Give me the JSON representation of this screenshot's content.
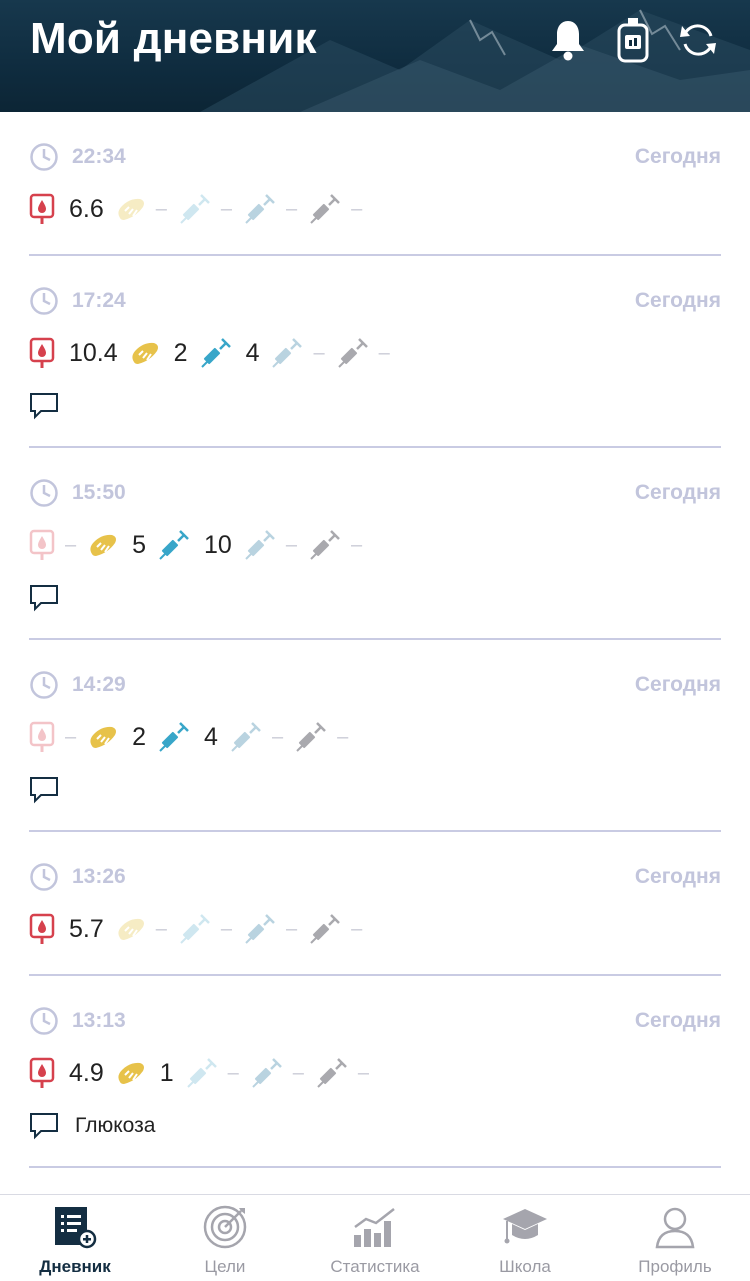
{
  "header": {
    "title": "Мой дневник"
  },
  "colors": {
    "glucose": "#d6414d",
    "bread": "#e7c24a",
    "short_insulin": "#38a6c9",
    "long_insulin": "#b9d3e0",
    "other_insulin": "#a9a9ae",
    "accent": "#142e42"
  },
  "entries": [
    {
      "time": "22:34",
      "day": "Сегодня",
      "glucose": "6.6",
      "bread": "",
      "short": "",
      "long": "",
      "other": "",
      "comment": null
    },
    {
      "time": "17:24",
      "day": "Сегодня",
      "glucose": "10.4",
      "bread": "2",
      "short": "4",
      "long": "",
      "other": "",
      "comment": ""
    },
    {
      "time": "15:50",
      "day": "Сегодня",
      "glucose": "",
      "bread": "5",
      "short": "10",
      "long": "",
      "other": "",
      "comment": ""
    },
    {
      "time": "14:29",
      "day": "Сегодня",
      "glucose": "",
      "bread": "2",
      "short": "4",
      "long": "",
      "other": "",
      "comment": ""
    },
    {
      "time": "13:26",
      "day": "Сегодня",
      "glucose": "5.7",
      "bread": "",
      "short": "",
      "long": "",
      "other": "",
      "comment": null
    },
    {
      "time": "13:13",
      "day": "Сегодня",
      "glucose": "4.9",
      "bread": "1",
      "short": "",
      "long": "",
      "other": "",
      "comment": "Глюкоза"
    }
  ],
  "tabs": [
    {
      "label": "Дневник",
      "icon": "diary-icon",
      "active": true
    },
    {
      "label": "Цели",
      "icon": "target-icon",
      "active": false
    },
    {
      "label": "Статистика",
      "icon": "chart-icon",
      "active": false
    },
    {
      "label": "Школа",
      "icon": "graduation-cap-icon",
      "active": false
    },
    {
      "label": "Профиль",
      "icon": "profile-icon",
      "active": false
    }
  ]
}
